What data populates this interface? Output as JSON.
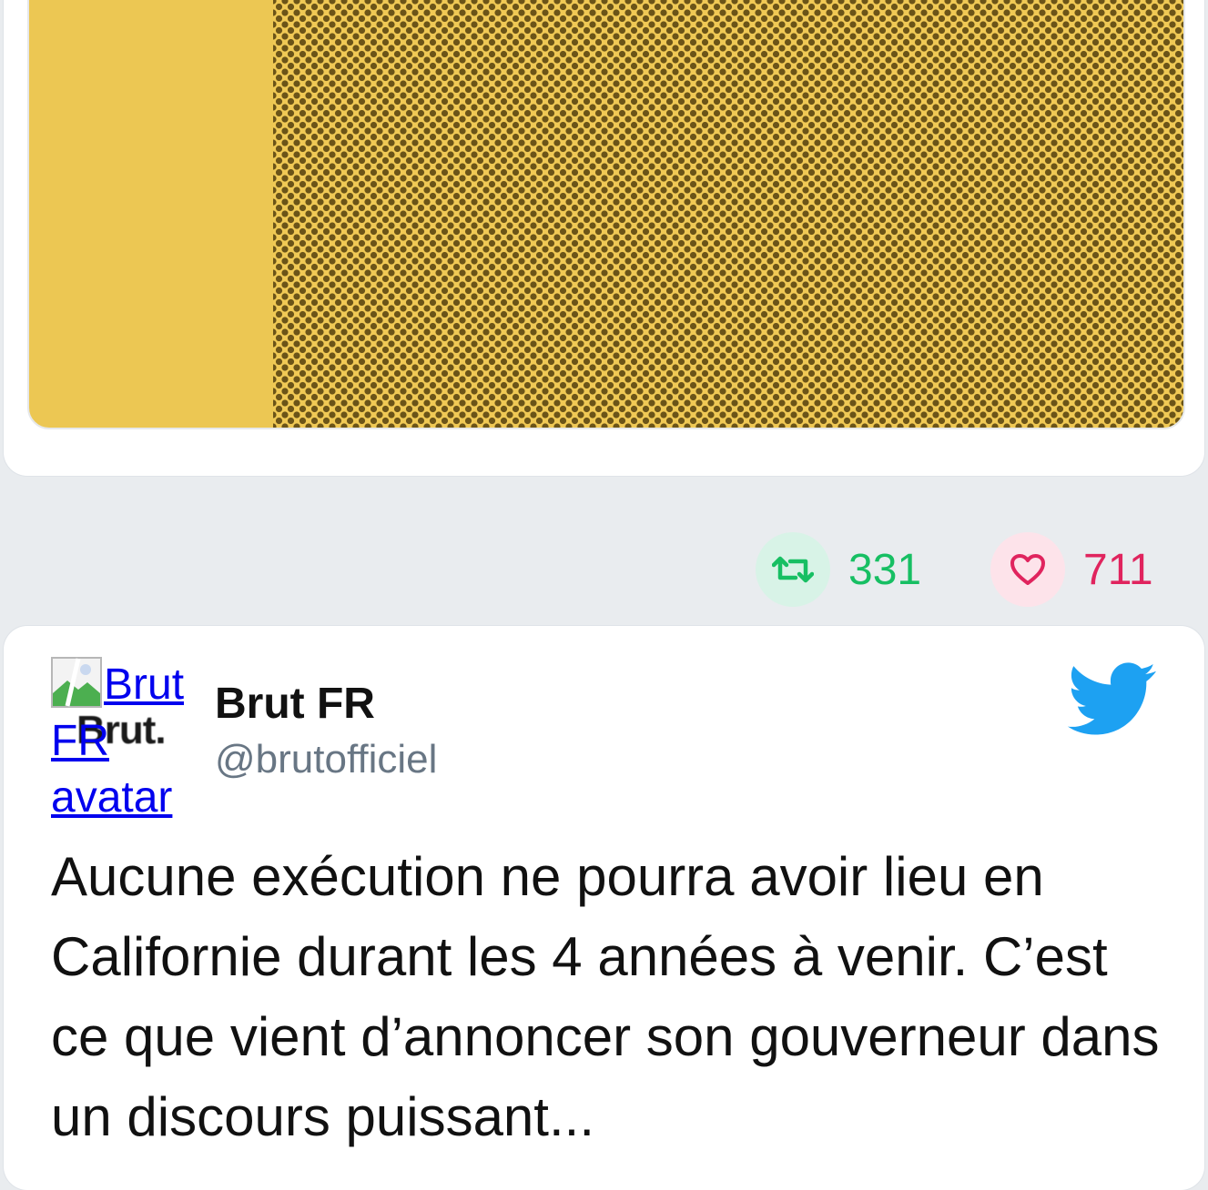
{
  "stats": {
    "retweets": "331",
    "likes": "711",
    "retweet_color": "#17bf63",
    "like_color": "#e0245e"
  },
  "media": {
    "colors": {
      "background": "#ecc753",
      "pattern_dot": "#6b5418"
    }
  },
  "tweet": {
    "avatar_alt": "Brut FR avatar",
    "avatar_logo_text": "Brut.",
    "author_name": "Brut FR",
    "author_handle": "@brutofficiel",
    "text": "Aucune exécution ne pourra avoir lieu en Californie durant les 4 années à venir. C’est ce que vient d’annoncer son gouverneur dans un discours puissant..."
  },
  "icons": {
    "retweet": "retweet-icon",
    "like": "heart-icon",
    "twitter": "twitter-bird-icon",
    "broken_image": "broken-image-icon"
  }
}
